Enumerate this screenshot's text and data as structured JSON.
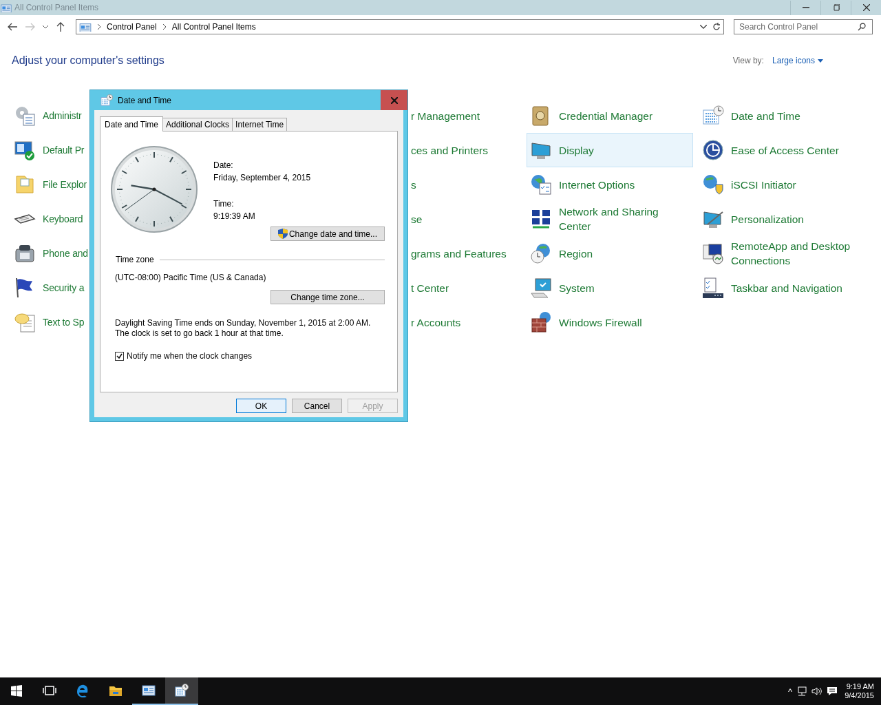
{
  "window": {
    "title": "All Control Panel Items"
  },
  "address_bar": {
    "crumbs": [
      "Control Panel",
      "All Control Panel Items"
    ]
  },
  "search": {
    "placeholder": "Search Control Panel"
  },
  "heading": "Adjust your computer's settings",
  "view_by": {
    "label": "View by:",
    "value": "Large icons"
  },
  "columns": [
    {
      "items": [
        {
          "kind": "admin",
          "label": "Administr",
          "selected": false
        },
        {
          "kind": "default",
          "label": "Default Pr",
          "selected": false
        },
        {
          "kind": "folder",
          "label": "File Explor",
          "selected": false
        },
        {
          "kind": "keyboard",
          "label": "Keyboard",
          "selected": false
        },
        {
          "kind": "phone",
          "label": "Phone and",
          "selected": false
        },
        {
          "kind": "flag",
          "label": "Security a",
          "selected": false
        },
        {
          "kind": "speech",
          "label": "Text to Sp",
          "selected": false
        }
      ]
    },
    {
      "items": [
        {
          "label": "r Management",
          "selected": false
        },
        {
          "label": "ces and Printers",
          "selected": false
        },
        {
          "label": "s",
          "selected": false
        },
        {
          "label": "se",
          "selected": false
        },
        {
          "label": "grams and Features",
          "selected": false
        },
        {
          "label": "t Center",
          "selected": false
        },
        {
          "label": "r Accounts",
          "selected": false
        }
      ]
    },
    {
      "items": [
        {
          "kind": "vault",
          "label": "Credential Manager",
          "selected": false
        },
        {
          "kind": "display",
          "label": "Display",
          "selected": true
        },
        {
          "kind": "internet",
          "label": "Internet Options",
          "selected": false
        },
        {
          "kind": "network",
          "label": "Network and Sharing Center",
          "selected": false
        },
        {
          "kind": "region",
          "label": "Region",
          "selected": false
        },
        {
          "kind": "system",
          "label": "System",
          "selected": false
        },
        {
          "kind": "firewall",
          "label": "Windows Firewall",
          "selected": false
        }
      ]
    },
    {
      "items": [
        {
          "kind": "calendar",
          "label": "Date and Time",
          "selected": false
        },
        {
          "kind": "ease",
          "label": "Ease of Access Center",
          "selected": false
        },
        {
          "kind": "iscsi",
          "label": "iSCSI Initiator",
          "selected": false
        },
        {
          "kind": "personalization",
          "label": "Personalization",
          "selected": false
        },
        {
          "kind": "remote",
          "label": "RemoteApp and Desktop Connections",
          "selected": false
        },
        {
          "kind": "taskbar",
          "label": "Taskbar and Navigation",
          "selected": false
        }
      ]
    }
  ],
  "dialog": {
    "title": "Date and Time",
    "tabs": [
      {
        "label": "Date and Time",
        "selected": true
      },
      {
        "label": "Additional Clocks",
        "selected": false
      },
      {
        "label": "Internet Time",
        "selected": false
      }
    ],
    "date_label": "Date:",
    "date": "Friday, September 4, 2015",
    "time_label": "Time:",
    "time": "9:19:39 AM",
    "change_datetime_button": "Change date and time...",
    "timezone_heading": "Time zone",
    "timezone": "(UTC-08:00) Pacific Time (US & Canada)",
    "change_timezone_button": "Change time zone...",
    "dst_note": "Daylight Saving Time ends on Sunday, November 1, 2015 at 2:00 AM. The clock is set to go back 1 hour at that time.",
    "notify": {
      "label": "Notify me when the clock changes",
      "checked": true
    },
    "buttons": [
      {
        "label": "OK",
        "disabled": false,
        "default": true
      },
      {
        "label": "Cancel",
        "disabled": false,
        "default": false
      },
      {
        "label": "Apply",
        "disabled": true,
        "default": false
      }
    ]
  },
  "taskbar": {
    "buttons": [
      {
        "kind": "start",
        "running": false,
        "active": false
      },
      {
        "kind": "taskview",
        "running": false,
        "active": false
      },
      {
        "kind": "edge",
        "running": false,
        "active": false
      },
      {
        "kind": "explorer",
        "running": false,
        "active": false
      },
      {
        "kind": "controlpanel",
        "running": true,
        "active": false
      },
      {
        "kind": "datetime",
        "running": true,
        "active": true
      }
    ],
    "tray": {
      "caret": "^",
      "time": "9:19 AM",
      "date": "9/4/2015"
    }
  }
}
